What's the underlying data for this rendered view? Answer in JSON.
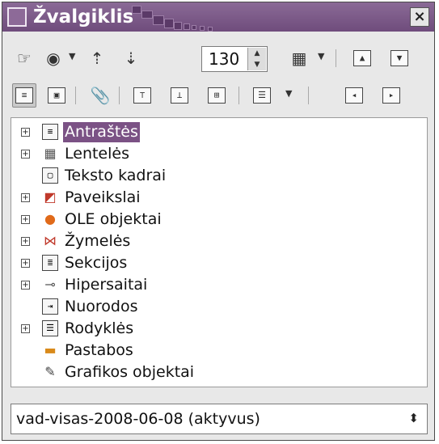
{
  "window": {
    "title": "Žvalgiklis",
    "close_glyph": "×"
  },
  "toolbar_row1": {
    "buttons": [
      {
        "name": "navigation-icon",
        "glyph": "☞"
      },
      {
        "name": "navigation-dropdown-icon",
        "glyph": "◉"
      },
      {
        "name": "previous-icon",
        "glyph": "⇡"
      },
      {
        "name": "next-icon",
        "glyph": "⇣"
      },
      {
        "name": "drag-mode-icon",
        "glyph": "▦"
      },
      {
        "name": "promote-chapter-icon",
        "glyph": "▲"
      },
      {
        "name": "demote-chapter-icon",
        "glyph": "▼"
      }
    ],
    "spin_value": "130"
  },
  "toolbar_row2": {
    "buttons": [
      {
        "name": "list-box-toggle-icon",
        "glyph": "≡",
        "active": true
      },
      {
        "name": "content-view-icon",
        "glyph": "▣"
      },
      {
        "name": "reminder-icon",
        "glyph": "📎"
      },
      {
        "name": "header-icon",
        "glyph": "⊤"
      },
      {
        "name": "footer-icon",
        "glyph": "⊥"
      },
      {
        "name": "anchor-text-icon",
        "glyph": "⊞"
      },
      {
        "name": "heading-levels-icon",
        "glyph": "☰"
      },
      {
        "name": "promote-level-icon",
        "glyph": "◂"
      },
      {
        "name": "demote-level-icon",
        "glyph": "▸"
      }
    ]
  },
  "tree": {
    "items": [
      {
        "label": "Antraštės",
        "expandable": true,
        "icon": "headings-icon",
        "glyph": "≡",
        "selected": true
      },
      {
        "label": "Lentelės",
        "expandable": true,
        "icon": "tables-icon",
        "glyph": "▦"
      },
      {
        "label": "Teksto kadrai",
        "expandable": false,
        "icon": "text-frames-icon",
        "glyph": "▢"
      },
      {
        "label": "Paveikslai",
        "expandable": true,
        "icon": "images-icon",
        "glyph": "◩"
      },
      {
        "label": "OLE objektai",
        "expandable": true,
        "icon": "ole-objects-icon",
        "glyph": "●"
      },
      {
        "label": "Žymelės",
        "expandable": true,
        "icon": "bookmarks-icon",
        "glyph": "⋈"
      },
      {
        "label": "Sekcijos",
        "expandable": true,
        "icon": "sections-icon",
        "glyph": "≣"
      },
      {
        "label": "Hipersaitai",
        "expandable": true,
        "icon": "hyperlinks-icon",
        "glyph": "⊸"
      },
      {
        "label": "Nuorodos",
        "expandable": false,
        "icon": "references-icon",
        "glyph": "⇥"
      },
      {
        "label": "Rodyklės",
        "expandable": true,
        "icon": "indexes-icon",
        "glyph": "☰"
      },
      {
        "label": "Pastabos",
        "expandable": false,
        "icon": "comments-icon",
        "glyph": "▬"
      },
      {
        "label": "Grafikos objektai",
        "expandable": false,
        "icon": "drawing-objects-icon",
        "glyph": "✎"
      }
    ],
    "expander_glyph": "+"
  },
  "document_select": {
    "value": "vad-visas-2008-06-08 (aktyvus)",
    "caret": "⬍"
  },
  "colors": {
    "titlebar": "#7b5285",
    "selection": "#7b5285",
    "window_bg": "#e8e8e8"
  }
}
